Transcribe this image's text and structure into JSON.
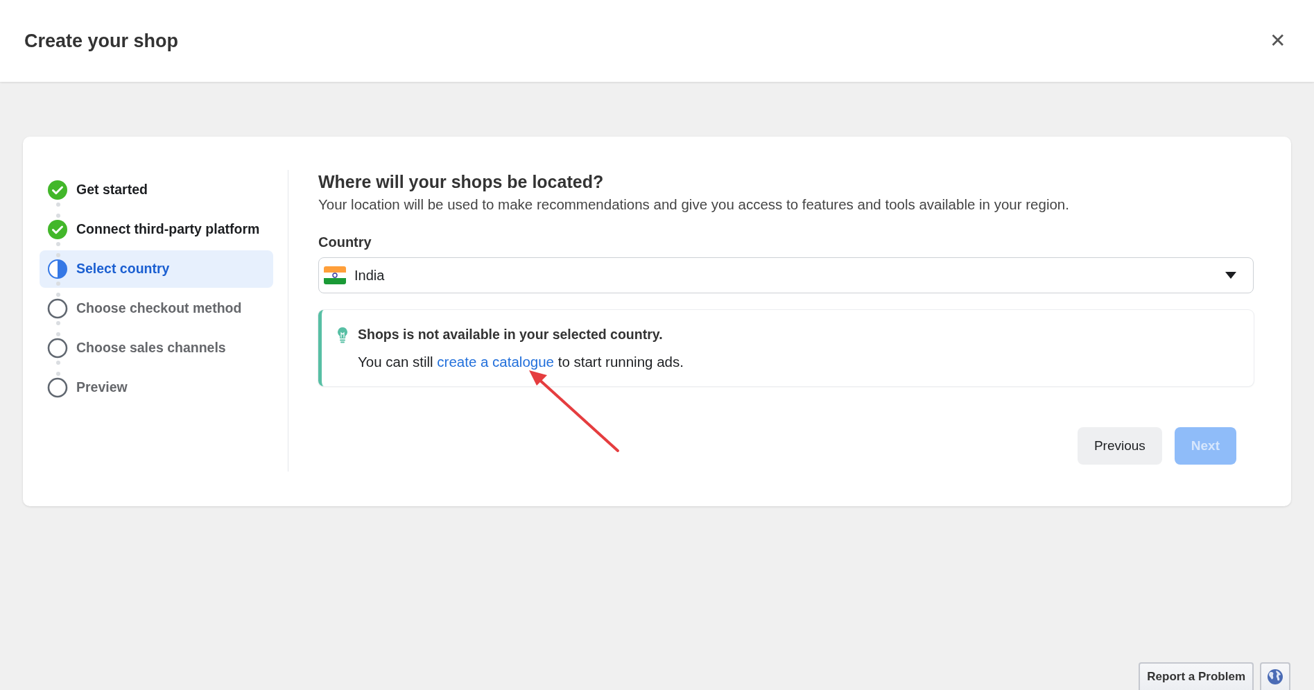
{
  "header": {
    "title": "Create your shop",
    "close_icon": "✕"
  },
  "steps": [
    {
      "label": "Get started",
      "completed": true,
      "selected": false
    },
    {
      "label": "Connect third-party platform",
      "completed": true,
      "selected": false
    },
    {
      "label": "Select country",
      "completed": false,
      "selected": true
    },
    {
      "label": "Choose checkout method",
      "completed": false,
      "selected": false
    },
    {
      "label": "Choose sales channels",
      "completed": false,
      "selected": false
    },
    {
      "label": "Preview",
      "completed": false,
      "selected": false
    }
  ],
  "form": {
    "heading": "Where will your shops be located?",
    "description": "Your location will be used to make recommendations and give you access to features and tools available in your region.",
    "country_label": "Country",
    "country_value": "India"
  },
  "notice": {
    "title": "Shops is not available in your selected country.",
    "text_before": "You can still",
    "link": "create a catalogue",
    "text_after": "to start running ads."
  },
  "buttons": [
    {
      "label": "Previous",
      "kind": "secondary",
      "disabled": false
    },
    {
      "label": "Next",
      "kind": "primary",
      "disabled": true
    }
  ],
  "footer": {
    "report": "Report a Problem"
  }
}
